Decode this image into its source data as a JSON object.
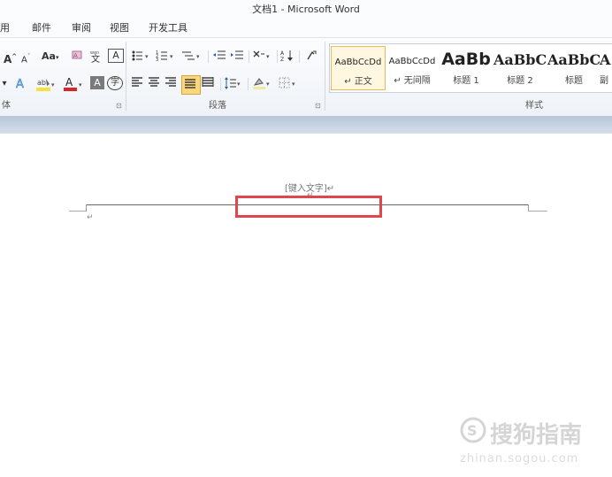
{
  "title_bar": {
    "title": "文档1  -  Microsoft Word"
  },
  "tabs": [
    "用",
    "邮件",
    "审阅",
    "视图",
    "开发工具"
  ],
  "font_group": {
    "label": "体",
    "grow_font": "A",
    "shrink_font": "A",
    "change_case": "Aa",
    "phonetic": "wén",
    "char_border": "A",
    "font_color": "A",
    "char_shading": "A",
    "enclose": "字",
    "highlight_color": "#f5e23b",
    "font_color_value": "#d6272a"
  },
  "paragraph_group": {
    "label": "段落"
  },
  "styles_group": {
    "label": "样式",
    "styles": [
      {
        "preview": "AaBbCcDd",
        "name": "↵ 正文",
        "selected": true
      },
      {
        "preview": "AaBbCcDd",
        "name": "↵ 无间隔",
        "selected": false
      },
      {
        "preview": "AaBb",
        "name": "标题 1",
        "selected": false
      },
      {
        "preview": "AaBbC",
        "name": "标题 2",
        "selected": false
      },
      {
        "preview": "AaBbC",
        "name": "标题",
        "selected": false
      },
      {
        "preview": "A",
        "name": "副",
        "selected": false
      }
    ]
  },
  "document": {
    "header_placeholder": "[键入文字]↵",
    "para_mark_header": "↵",
    "para_mark_body": "↵"
  },
  "watermark": {
    "text_cn": "搜狗指南",
    "text_en": "zhinan.sogou.com"
  }
}
